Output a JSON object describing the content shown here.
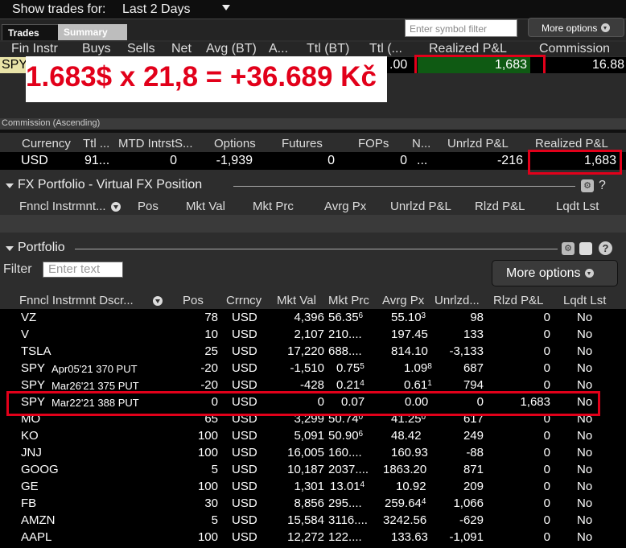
{
  "topbar": {
    "show_label": "Show trades for:",
    "period": "Last 2 Days"
  },
  "tabs": [
    "Trades",
    "Summary"
  ],
  "symbol_filter_placeholder": "Enter symbol filter",
  "more_options_small": "More options",
  "trades_columns": [
    "Fin Instr",
    "Buys",
    "Sells",
    "Net",
    "Avg (BT)",
    "A...",
    "Ttl (BT)",
    "Ttl (...",
    "Realized P&L",
    "Commission"
  ],
  "trades_row": {
    "symbol": "SPY",
    "partial_value": ".00",
    "realized_pl": "1,683",
    "commission": "16.88"
  },
  "overlay_text": "1.683$ x 21,8 = +36.689 Kč",
  "commission_sort": "Commission (Ascending)",
  "summary_columns": [
    "Currency",
    "Ttl ...",
    "MTD IntrstS...",
    "Options",
    "Futures",
    "FOPs",
    "N...",
    "Unrlzd P&L",
    "Realized P&L"
  ],
  "summary_row": {
    "currency": "USD",
    "ttl": "91...",
    "mtd": "0",
    "options": "-1,939",
    "futures": "0",
    "fops": "0",
    "n": "...",
    "unrlzd": "-216",
    "realized": "1,683"
  },
  "fx_section": {
    "title": "FX Portfolio - Virtual FX Position",
    "columns": [
      "Fnncl Instrmnt...",
      "Pos",
      "Mkt Val",
      "Mkt Prc",
      "Avrg Px",
      "Unrlzd P&L",
      "Rlzd P&L",
      "Lqdt Lst"
    ]
  },
  "portfolio_section": {
    "title": "Portfolio",
    "filter_label": "Filter",
    "filter_placeholder": "Enter text",
    "more_options": "More options"
  },
  "portfolio_columns": [
    "Fnncl Instrmnt Dscr...",
    "Pos",
    "Crrncy",
    "Mkt Val",
    "Mkt Prc",
    "Avrg Px",
    "Unrlzd...",
    "Rlzd P&L",
    "Lqdt Lst"
  ],
  "portfolio_rows": [
    {
      "sym": "VZ",
      "sub": "",
      "pos": "78",
      "cur": "USD",
      "mval": "4,396",
      "mprc": "56.35",
      "mprc_sup": "6",
      "avg": "55.10",
      "avg_sup": "3",
      "unr": "98",
      "rlz": "0",
      "lqd": "No"
    },
    {
      "sym": "V",
      "sub": "",
      "pos": "10",
      "cur": "USD",
      "mval": "2,107",
      "mprc": "210....",
      "mprc_sup": "",
      "avg": "197.45",
      "avg_sup": "",
      "unr": "133",
      "rlz": "0",
      "lqd": "No"
    },
    {
      "sym": "TSLA",
      "sub": "",
      "pos": "25",
      "cur": "USD",
      "mval": "17,220",
      "mprc": "688....",
      "mprc_sup": "",
      "avg": "814.10",
      "avg_sup": "",
      "unr": "-3,133",
      "rlz": "0",
      "lqd": "No"
    },
    {
      "sym": "SPY",
      "sub": "Apr05'21 370 PUT",
      "pos": "-20",
      "cur": "USD",
      "mval": "-1,510",
      "mprc": "0.75",
      "mprc_sup": "5",
      "avg": "1.09",
      "avg_sup": "8",
      "unr": "687",
      "rlz": "0",
      "lqd": "No"
    },
    {
      "sym": "SPY",
      "sub": "Mar26'21 375 PUT",
      "pos": "-20",
      "cur": "USD",
      "mval": "-428",
      "mprc": "0.21",
      "mprc_sup": "4",
      "avg": "0.61",
      "avg_sup": "1",
      "unr": "794",
      "rlz": "0",
      "lqd": "No"
    },
    {
      "sym": "SPY",
      "sub": "Mar22'21 388 PUT",
      "pos": "0",
      "cur": "USD",
      "mval": "0",
      "mprc": "0.07",
      "mprc_sup": "",
      "avg": "0.00",
      "avg_sup": "",
      "unr": "0",
      "rlz": "1,683",
      "lqd": "No"
    },
    {
      "sym": "MO",
      "sub": "",
      "pos": "65",
      "cur": "USD",
      "mval": "3,299",
      "mprc": "50.74",
      "mprc_sup": "0",
      "avg": "41.25",
      "avg_sup": "0",
      "unr": "617",
      "rlz": "0",
      "lqd": "No"
    },
    {
      "sym": "KO",
      "sub": "",
      "pos": "100",
      "cur": "USD",
      "mval": "5,091",
      "mprc": "50.90",
      "mprc_sup": "6",
      "avg": "48.42",
      "avg_sup": "",
      "unr": "249",
      "rlz": "0",
      "lqd": "No"
    },
    {
      "sym": "JNJ",
      "sub": "",
      "pos": "100",
      "cur": "USD",
      "mval": "16,005",
      "mprc": "160....",
      "mprc_sup": "",
      "avg": "160.93",
      "avg_sup": "",
      "unr": "-88",
      "rlz": "0",
      "lqd": "No"
    },
    {
      "sym": "GOOG",
      "sub": "",
      "pos": "5",
      "cur": "USD",
      "mval": "10,187",
      "mprc": "2037....",
      "mprc_sup": "",
      "avg": "1863.20",
      "avg_sup": "",
      "unr": "871",
      "rlz": "0",
      "lqd": "No"
    },
    {
      "sym": "GE",
      "sub": "",
      "pos": "100",
      "cur": "USD",
      "mval": "1,301",
      "mprc": "13.01",
      "mprc_sup": "4",
      "avg": "10.92",
      "avg_sup": "",
      "unr": "209",
      "rlz": "0",
      "lqd": "No"
    },
    {
      "sym": "FB",
      "sub": "",
      "pos": "30",
      "cur": "USD",
      "mval": "8,856",
      "mprc": "295....",
      "mprc_sup": "",
      "avg": "259.64",
      "avg_sup": "4",
      "unr": "1,066",
      "rlz": "0",
      "lqd": "No"
    },
    {
      "sym": "AMZN",
      "sub": "",
      "pos": "5",
      "cur": "USD",
      "mval": "15,584",
      "mprc": "3116....",
      "mprc_sup": "",
      "avg": "3242.56",
      "avg_sup": "",
      "unr": "-629",
      "rlz": "0",
      "lqd": "No"
    },
    {
      "sym": "AAPL",
      "sub": "",
      "pos": "100",
      "cur": "USD",
      "mval": "12,272",
      "mprc": "122....",
      "mprc_sup": "",
      "avg": "133.63",
      "avg_sup": "",
      "unr": "-1,091",
      "rlz": "0",
      "lqd": "No"
    }
  ],
  "colors": {
    "highlight_red": "#e2001a",
    "realized_green": "#0f5a13",
    "spy_cell": "#e8e3a8"
  }
}
